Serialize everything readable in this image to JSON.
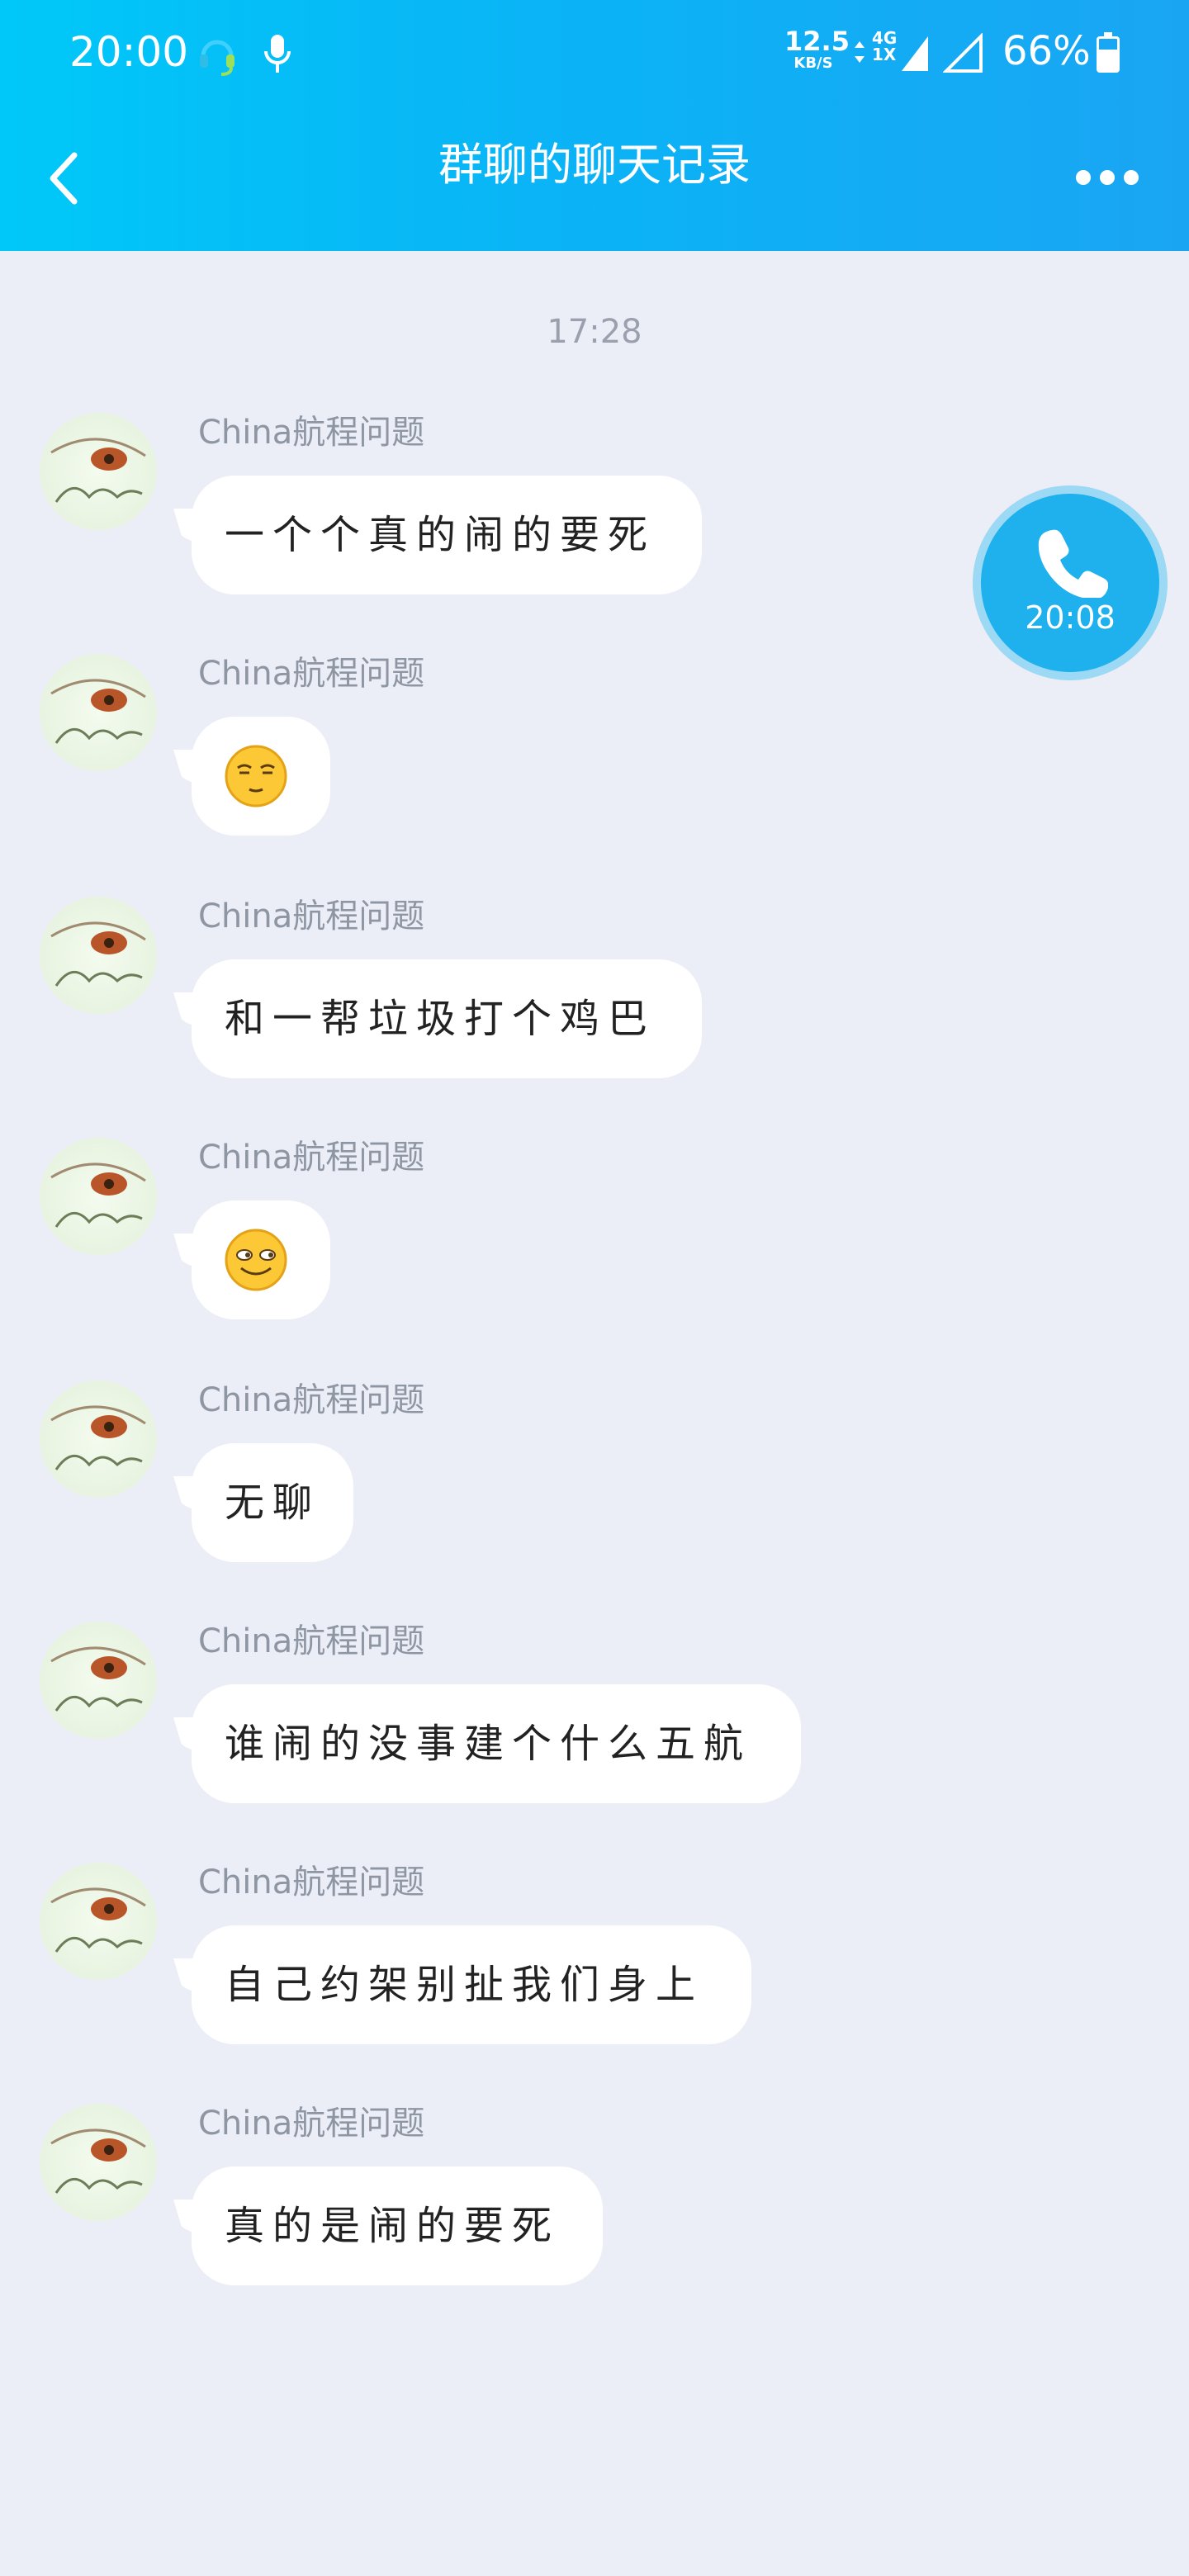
{
  "status_bar": {
    "time": "20:00",
    "speed_value": "12.5",
    "speed_unit": "KB/S",
    "network_top": "4G",
    "network_bottom": "1X",
    "battery": "66%",
    "icons": [
      "headset-icon",
      "microphone-icon",
      "signal-icon",
      "battery-icon"
    ]
  },
  "header": {
    "title": "群聊的聊天记录",
    "back_icon": "chevron-left-icon",
    "more_icon": "more-dots-icon"
  },
  "chat": {
    "time_divider": "17:28",
    "messages": [
      {
        "sender": "China航程问题",
        "type": "text",
        "text": "一个个真的闹的要死"
      },
      {
        "sender": "China航程问题",
        "type": "emoji",
        "emoji": "smug-emoji"
      },
      {
        "sender": "China航程问题",
        "type": "text",
        "text": "和一帮垃圾打个鸡巴"
      },
      {
        "sender": "China航程问题",
        "type": "emoji",
        "emoji": "sly-smile-emoji"
      },
      {
        "sender": "China航程问题",
        "type": "text",
        "text": "无聊"
      },
      {
        "sender": "China航程问题",
        "type": "text",
        "text": "谁闹的没事建个什么五航"
      },
      {
        "sender": "China航程问题",
        "type": "text",
        "text": "自己约架别扯我们身上"
      },
      {
        "sender": "China航程问题",
        "type": "text",
        "text": "真的是闹的要死"
      }
    ]
  },
  "call_float": {
    "duration": "20:08",
    "icon": "phone-icon"
  }
}
